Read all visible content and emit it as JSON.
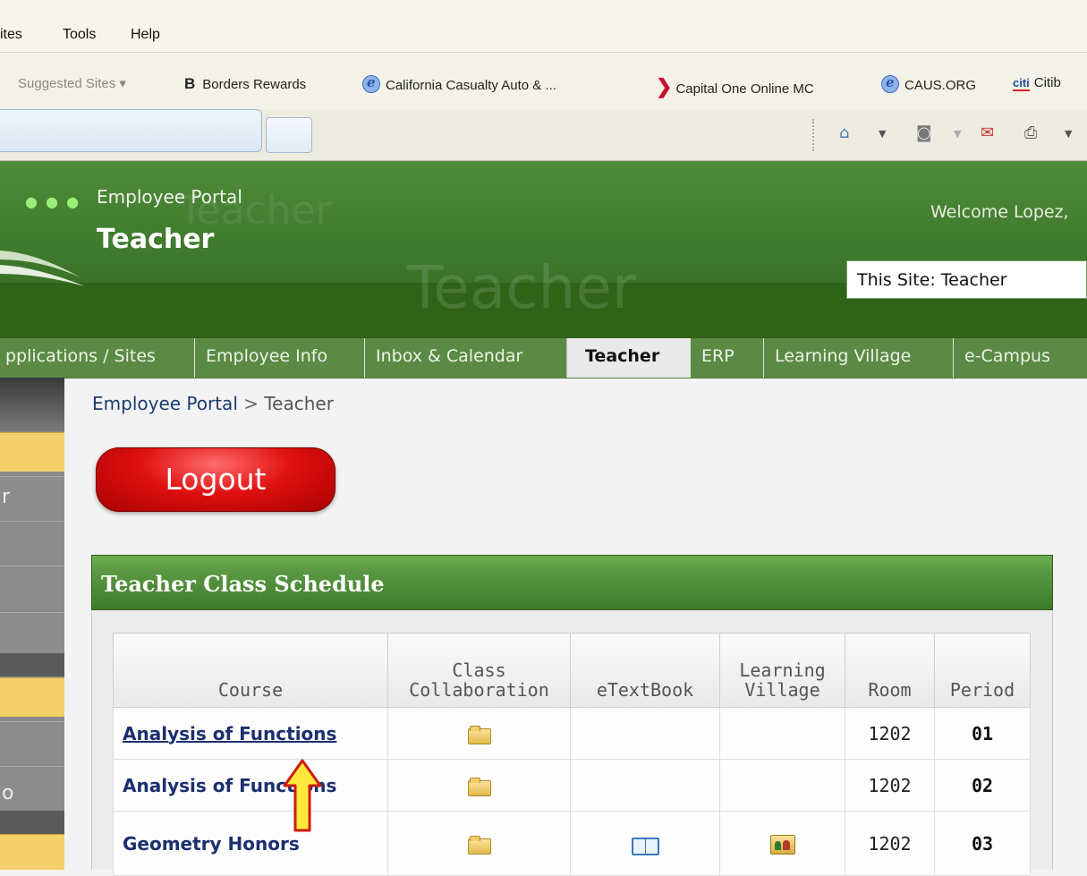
{
  "browser": {
    "menu": [
      "ites",
      "Tools",
      "Help"
    ],
    "favorites": [
      {
        "label": "Suggested Sites ▾",
        "icon": "none"
      },
      {
        "label": "Borders Rewards",
        "icon": "b-logo-icon"
      },
      {
        "label": "California Casualty Auto & ...",
        "icon": "ie-icon"
      },
      {
        "label": "Capital One Online MC",
        "icon": "capital-one-icon"
      },
      {
        "label": "CAUS.ORG",
        "icon": "ie-icon"
      },
      {
        "label": "Citib",
        "icon": "citi-icon"
      }
    ],
    "toolbar_icons": [
      "home-icon",
      "rss-feed-icon",
      "read-mail-icon",
      "print-icon"
    ]
  },
  "portal": {
    "header_title": "Employee Portal",
    "site_title": "Teacher",
    "ghost_text": "Teacher",
    "welcome": "Welcome Lopez,",
    "site_selector": "This Site: Teacher"
  },
  "nav": {
    "tabs": [
      "pplications / Sites",
      "Employee Info",
      "Inbox & Calendar",
      "Teacher",
      "ERP",
      "Learning Village",
      "e-Campus"
    ],
    "active": "Teacher"
  },
  "sidebar": {
    "letters": [
      "r",
      "o"
    ]
  },
  "breadcrumb": {
    "root": "Employee Portal",
    "separator": ">",
    "current": "Teacher"
  },
  "logout": {
    "label": "Logout"
  },
  "schedule": {
    "title": "Teacher Class Schedule",
    "headers": {
      "course": "Course",
      "collab_1": "Class",
      "collab_2": "Collaboration",
      "etextbook": "eTextBook",
      "lv_1": "Learning",
      "lv_2": "Village",
      "room": "Room",
      "period": "Period"
    },
    "rows": [
      {
        "course": "Analysis of Functions",
        "collab": true,
        "etextbook": false,
        "learning_village": false,
        "room": "1202",
        "period": "01"
      },
      {
        "course": "Analysis of Functions",
        "collab": true,
        "etextbook": false,
        "learning_village": false,
        "room": "1202",
        "period": "02"
      },
      {
        "course": "Geometry Honors",
        "collab": true,
        "etextbook": true,
        "learning_village": true,
        "room": "1202",
        "period": "03"
      }
    ]
  },
  "colors": {
    "header_green": "#3f7a2d",
    "nav_green": "#5a8a43",
    "logout_red": "#e01010",
    "course_link": "#1c2f6e",
    "sidebar_yellow": "#f4cf6a"
  }
}
